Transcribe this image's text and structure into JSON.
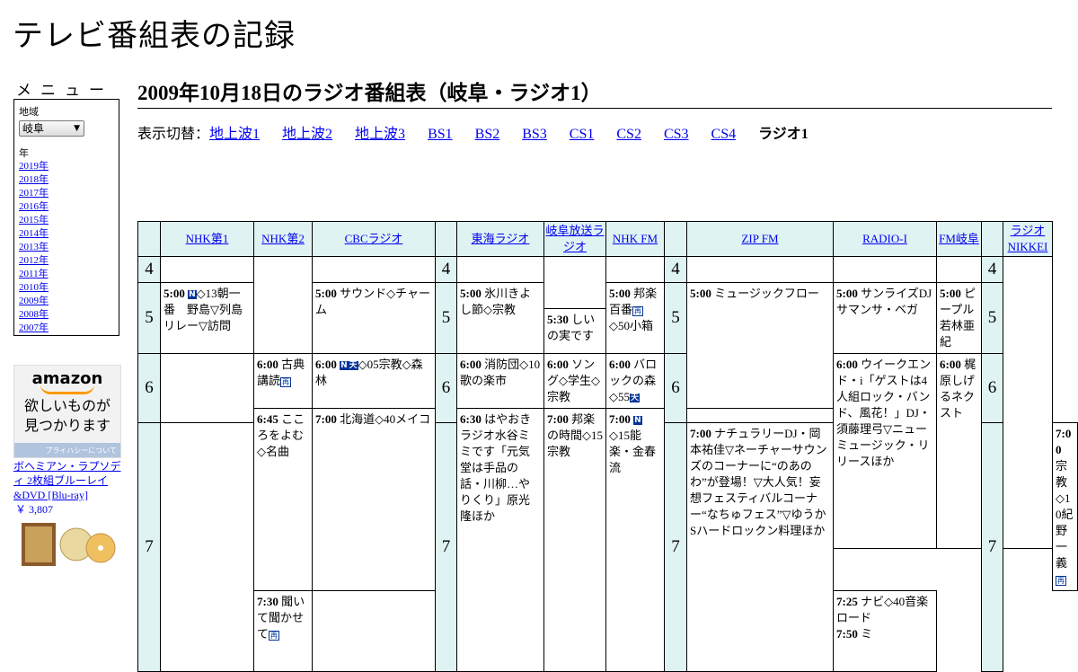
{
  "site_title": "テレビ番組表の記録",
  "menu": {
    "heading": "メニュー",
    "region_label": "地域",
    "region_value": "岐阜",
    "year_label": "年",
    "years": [
      "2019年",
      "2018年",
      "2017年",
      "2016年",
      "2015年",
      "2014年",
      "2013年",
      "2012年",
      "2011年",
      "2010年",
      "2009年",
      "2008年",
      "2007年"
    ]
  },
  "ad": {
    "brand": "amazon",
    "tagline_1": "欲しいものが",
    "tagline_2": "見つかります",
    "privacy": "プライバシーについて",
    "product_title": "ボヘミアン・ラプソディ 2枚組ブルーレイ&DVD [Blu-ray]",
    "product_price": "￥ 3,807"
  },
  "page_title": "2009年10月18日のラジオ番組表（岐阜・ラジオ1）",
  "switch": {
    "label": "表示切替：",
    "links": [
      "地上波1",
      "地上波2",
      "地上波3",
      "BS1",
      "BS2",
      "BS3",
      "CS1",
      "CS2",
      "CS3",
      "CS4"
    ],
    "current": "ラジオ1"
  },
  "stations": [
    "NHK第1",
    "NHK第2",
    "CBCラジオ",
    "東海ラジオ",
    "岐阜放送ラジオ",
    "NHK FM",
    "ZIP FM",
    "RADIO-I",
    "FM岐阜",
    "ラジオNIKKEI"
  ],
  "hours": [
    "4",
    "5",
    "6",
    "7"
  ],
  "programs": {
    "nhk1_500_time": "5:00",
    "nhk1_500_title": "◇13朝一番　野島▽列島リレー▽訪問",
    "nhk2_600_time": "6:00",
    "nhk2_600_title": "古典講読",
    "nhk2_645_time": "6:45",
    "nhk2_645_title": "こころをよむ◇名曲",
    "nhk2_730_time": "7:30",
    "nhk2_730_title": "聞いて聞かせて",
    "cbc_500_time": "5:00",
    "cbc_500_title": "サウンド◇チャーム",
    "cbc_600_time": "6:00",
    "cbc_600_title": "◇05宗教◇森林",
    "cbc_700_time": "7:00",
    "cbc_700_title": "北海道◇40メイコ",
    "tokai_500_time": "5:00",
    "tokai_500_title": "氷川きよし節◇宗教",
    "tokai_600_time": "6:00",
    "tokai_600_title": "消防団◇10歌の楽市",
    "tokai_630_time": "6:30",
    "tokai_630_title": "はやおきラジオ水谷ミミです「元気堂は手品の話・川柳…やりくり」原光隆ほか",
    "gifu_530_time": "5:30",
    "gifu_530_title": "しいの実です",
    "gifu_600_time": "6:00",
    "gifu_600_title": "ソング◇学生◇宗教",
    "gifu_700_time": "7:00",
    "gifu_700_title": "邦楽の時間◇15宗教",
    "nhkfm_500_time": "5:00",
    "nhkfm_500_title": "邦楽百番",
    "nhkfm_500_sub": "◇50小箱",
    "nhkfm_600_time": "6:00",
    "nhkfm_600_title": "バロックの森◇55",
    "nhkfm_700_time": "7:00",
    "nhkfm_700_title": "◇15能楽・金春流",
    "zip_500_time": "5:00",
    "zip_500_title": "ミュージックフロー",
    "zip_700_time": "7:00",
    "zip_700_title": "ナチュラリーDJ・岡本祐佳▽ネーチャーサウンズのコーナーに“のあのわ”が登場！▽大人気！妄想フェスティバルコーナー“なちゅフェス”▽ゆうかSハードロックン料理ほか",
    "radioi_500_time": "5:00",
    "radioi_500_title": "サンライズDJサマンサ・ベガ",
    "radioi_600_time": "6:00",
    "radioi_600_title": "ウイークエンド・i「ゲストは4人組ロック・バンド、風花！」DJ・須藤理弓▽ニューミュージック・リリースほか",
    "fmgifu_500_time": "5:00",
    "fmgifu_500_title": "ピープル若林亜紀",
    "fmgifu_600_time": "6:00",
    "fmgifu_600_title": "梶原しげるネクスト",
    "nikkei_700_time": "7:00",
    "nikkei_700_title": "宗教◇10紀野一義",
    "nikkei_725_time": "7:25",
    "nikkei_725_title": "ナビ◇40音楽ロード",
    "nikkei_750_time": "7:50",
    "nikkei_750_title": "ミ"
  },
  "badges": {
    "news": "N",
    "stereo": "S",
    "rerun": "再",
    "weather": "天"
  }
}
